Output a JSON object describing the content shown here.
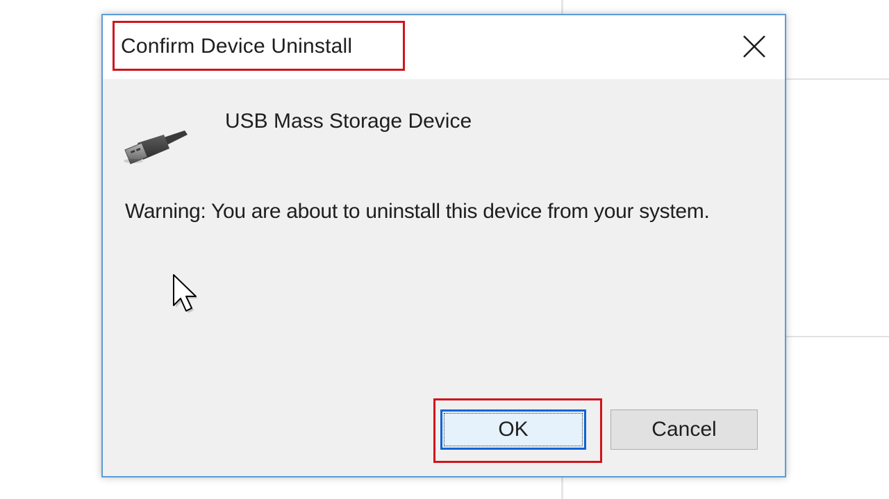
{
  "dialog": {
    "title": "Confirm Device Uninstall",
    "device_name": "USB Mass Storage Device",
    "warning": "Warning: You are about to uninstall this device from your system.",
    "buttons": {
      "ok_label": "OK",
      "cancel_label": "Cancel"
    }
  },
  "icons": {
    "close": "close-icon",
    "device": "usb-connector-icon",
    "cursor": "mouse-pointer-icon"
  },
  "colors": {
    "dialog_border": "#5a9bd8",
    "highlight_annotation": "#d0141c",
    "default_button_border": "#0a64d6",
    "dialog_background": "#f0f0f0"
  }
}
